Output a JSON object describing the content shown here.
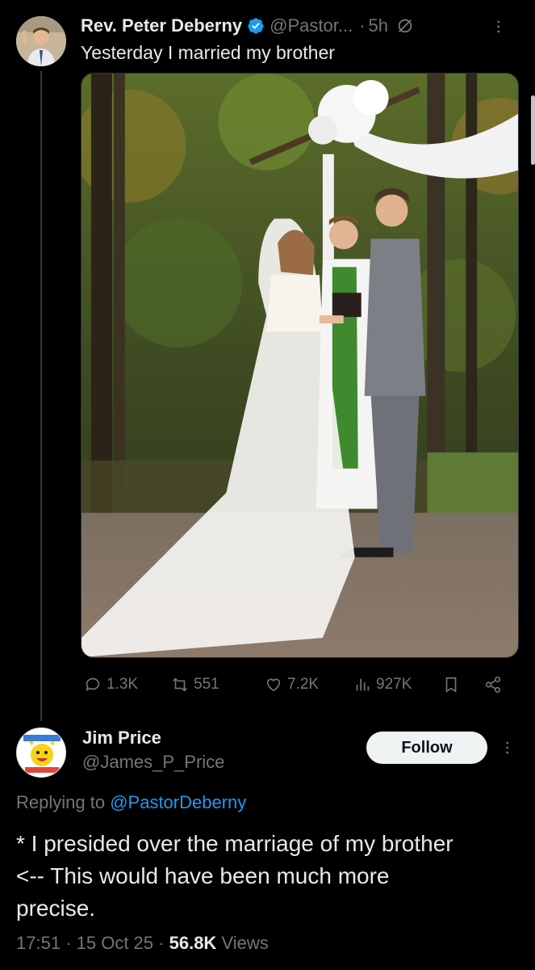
{
  "original_post": {
    "author_name": "Rev. Peter Deberny",
    "handle": "@Pastor...",
    "separator": "·",
    "time": "5h",
    "text": "Yesterday I married my brother",
    "avatar_icon": "person-avatar",
    "verified_icon": "verified-badge-icon",
    "grok_icon": "grok-icon",
    "more_icon": "more-vertical-icon",
    "media_description_icon": "wedding-photo"
  },
  "actions": {
    "replies": "1.3K",
    "reposts": "551",
    "likes": "7.2K",
    "views": "927K",
    "reply_icon": "reply-icon",
    "repost_icon": "repost-icon",
    "like_icon": "heart-icon",
    "views_icon": "views-chart-icon",
    "bookmark_icon": "bookmark-icon",
    "share_icon": "share-icon"
  },
  "reply_post": {
    "author_name": "Jim Price",
    "handle": "@James_P_Price",
    "follow_label": "Follow",
    "replying_prefix": "Replying to",
    "replying_to": "@PastorDeberny",
    "text": "* I presided over the marriage of my brother\n<-- This would have been much more\nprecise.",
    "avatar_icon": "cartoon-avatar",
    "more_icon": "more-vertical-icon"
  },
  "meta": {
    "time": "17:51",
    "sep1": "·",
    "date": "15 Oct 25",
    "sep2": "·",
    "views_count": "56.8K",
    "views_label": "Views"
  },
  "colors": {
    "background": "#000000",
    "text_primary": "#e7e9ea",
    "text_secondary": "#71767b",
    "link": "#1d9bf0",
    "verified": "#1d9bf0"
  }
}
